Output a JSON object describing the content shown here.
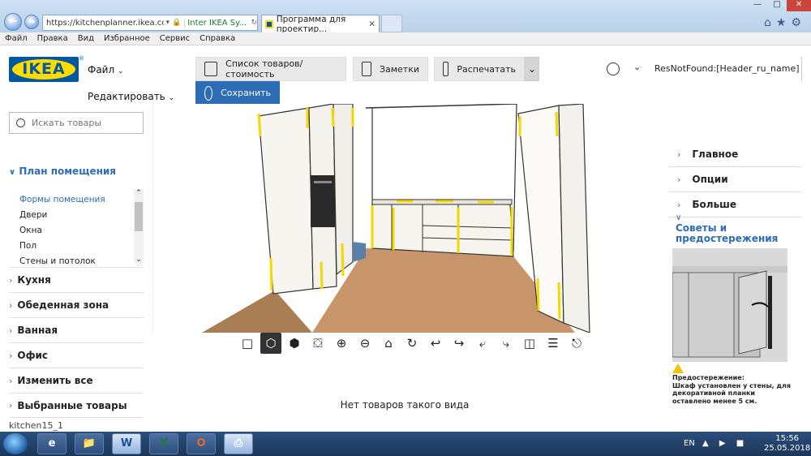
{
  "browser": {
    "address_url": "https://kitchenplanner.ikea.com/ru",
    "address_cert": "Inter IKEA Sy...",
    "tab_title": "Программа для проектир...",
    "menu": [
      "Файл",
      "Правка",
      "Вид",
      "Избранное",
      "Сервис",
      "Справка"
    ]
  },
  "app": {
    "logo_text": "IKEA",
    "logo_reg": "®",
    "menu_file": "Файл",
    "menu_edit": "Редактировать",
    "btn_products": "Список товаров/стоимость",
    "btn_notes": "Заметки",
    "btn_print": "Распечатать",
    "btn_save": "Сохранить",
    "user_name": "ResNotFound:[Header_ru_name]"
  },
  "sidebar": {
    "search_placeholder": "Искать товары",
    "room_plan": "План помещения",
    "sub_items": [
      "Формы помещения",
      "Двери",
      "Окна",
      "Пол",
      "Стены и потолок"
    ],
    "categories": [
      "Кухня",
      "Обеденная зона",
      "Ванная",
      "Офис",
      "Изменить все",
      "Выбранные товары"
    ],
    "project_name": "kitchen15_1"
  },
  "canvas": {
    "empty_message": "Нет товаров такого вида"
  },
  "right_panel": {
    "items": [
      "Главное",
      "Опции",
      "Больше"
    ],
    "tips_title": "Советы и предостережения",
    "warning_label": "Предостережение:",
    "warning_text": "Шкаф установлен у стены, для декоративной планки оставлено менее 5 см."
  },
  "taskbar": {
    "lang": "EN",
    "time": "15:56",
    "date": "25.05.2018"
  },
  "colors": {
    "ikea_blue": "#0058a3",
    "ikea_yellow": "#ffdb00",
    "accent": "#2c6db5",
    "floor": "#c8956a"
  }
}
